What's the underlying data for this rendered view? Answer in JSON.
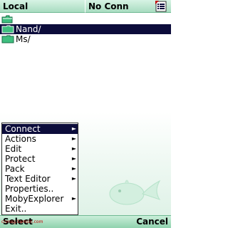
{
  "header": {
    "left_tab": "Local",
    "right_tab": "No Conn",
    "menu_icon": "list-menu-icon"
  },
  "up_folder_icon": "folder-up-icon",
  "files": [
    {
      "name": "Nand/",
      "icon": "folder-icon",
      "selected": true
    },
    {
      "name": "Ms/",
      "icon": "folder-icon",
      "selected": false
    }
  ],
  "menu": {
    "items": [
      {
        "label": "Connect",
        "submenu": true,
        "active": true
      },
      {
        "label": "Actions",
        "submenu": true,
        "active": false
      },
      {
        "label": "Edit",
        "submenu": true,
        "active": false
      },
      {
        "label": "Protect",
        "submenu": true,
        "active": false
      },
      {
        "label": "Pack",
        "submenu": true,
        "active": false
      },
      {
        "label": "Text Editor",
        "submenu": true,
        "active": false
      },
      {
        "label": "Properties..",
        "submenu": false,
        "active": false
      },
      {
        "label": "MobyExplorer",
        "submenu": true,
        "active": false
      },
      {
        "label": "Exit..",
        "submenu": false,
        "active": false
      }
    ],
    "chevron_glyph": "►"
  },
  "softkeys": {
    "left": "Select",
    "right": "Cancel"
  },
  "watermark_text": "cnmsg.Samsin.com",
  "colors": {
    "accent_green": "#a8dcc0",
    "selection_navy": "#0c0c3b",
    "folder_green": "#3fbf7f"
  }
}
